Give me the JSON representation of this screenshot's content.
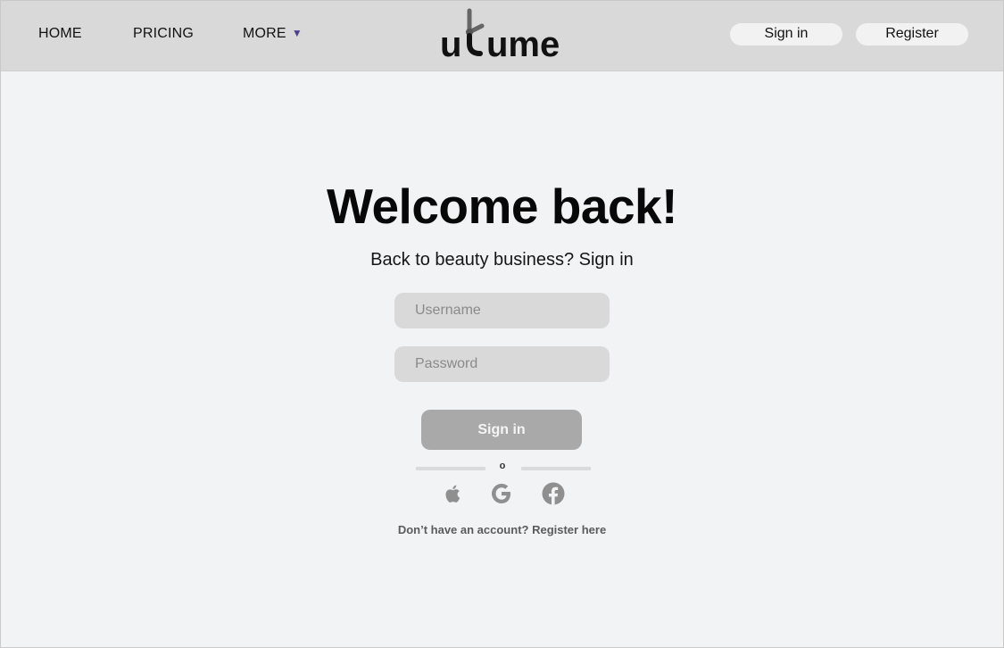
{
  "nav": {
    "home_label": "HOME",
    "pricing_label": "PRICING",
    "more_label": "MORE",
    "more_caret": "▼"
  },
  "logo": {
    "brand_text": "ume",
    "first_letter": "u"
  },
  "header_actions": {
    "signin_label": "Sign in",
    "register_label": "Register"
  },
  "main": {
    "title": "Welcome back!",
    "subtitle": "Back to beauty business? Sign in",
    "username_placeholder": "Username",
    "password_placeholder": "Password",
    "signin_button_label": "Sign in",
    "divider_text": "o",
    "footer_prefix": "Don’t have an account? ",
    "footer_link": "Register here"
  },
  "social": {
    "apple_icon": "apple-icon",
    "google_icon": "google-icon",
    "facebook_icon": "facebook-icon"
  },
  "colors": {
    "navbar_bg": "#d9d9d9",
    "page_bg": "#f2f3f5",
    "caret_accent": "#4c3f8f",
    "signin_button_bg": "#a9a9a9",
    "input_bg": "#d9d9d9"
  }
}
